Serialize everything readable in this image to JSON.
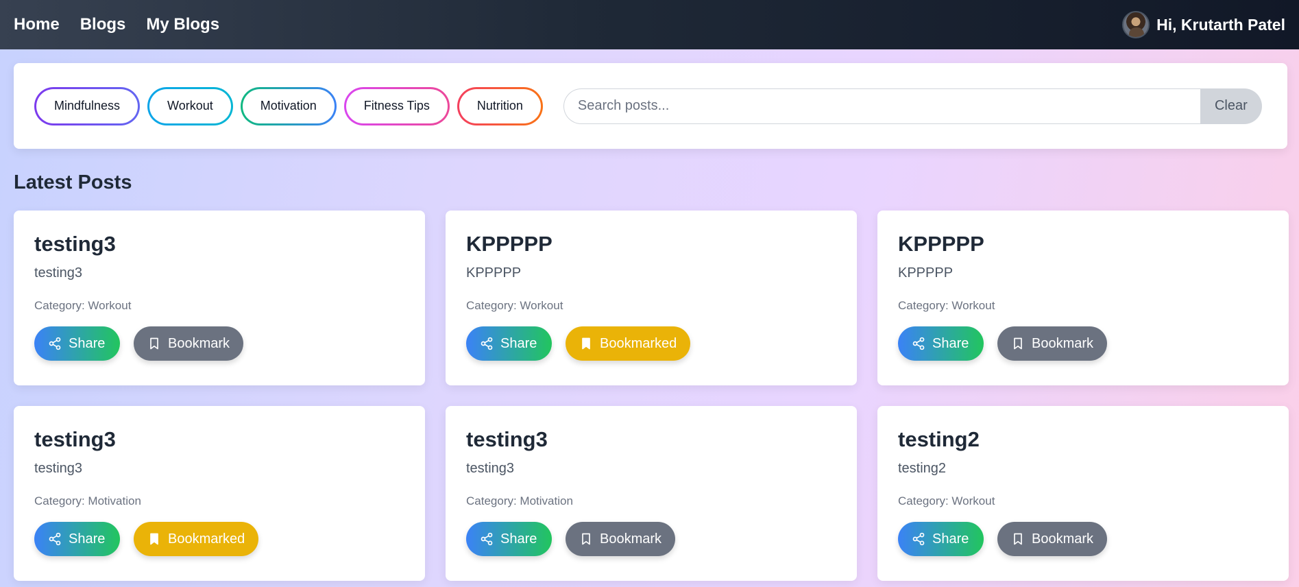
{
  "nav": {
    "links": [
      "Home",
      "Blogs",
      "My Blogs"
    ],
    "greeting": "Hi, Krutarth Patel"
  },
  "filters": {
    "chips": [
      "Mindfulness",
      "Workout",
      "Motivation",
      "Fitness Tips",
      "Nutrition"
    ],
    "search_placeholder": "Search posts...",
    "search_value": "",
    "clear_label": "Clear"
  },
  "section_title": "Latest Posts",
  "posts": [
    {
      "title": "testing3",
      "body": "testing3",
      "category": "Category: Workout",
      "share": "Share",
      "bookmark": "Bookmark",
      "bookmarked": false
    },
    {
      "title": "KPPPPP",
      "body": "KPPPPP",
      "category": "Category: Workout",
      "share": "Share",
      "bookmark": "Bookmarked",
      "bookmarked": true
    },
    {
      "title": "KPPPPP",
      "body": "KPPPPP",
      "category": "Category: Workout",
      "share": "Share",
      "bookmark": "Bookmark",
      "bookmarked": false
    },
    {
      "title": "testing3",
      "body": "testing3",
      "category": "Category: Motivation",
      "share": "Share",
      "bookmark": "Bookmarked",
      "bookmarked": true
    },
    {
      "title": "testing3",
      "body": "testing3",
      "category": "Category: Motivation",
      "share": "Share",
      "bookmark": "Bookmark",
      "bookmarked": false
    },
    {
      "title": "testing2",
      "body": "testing2",
      "category": "Category: Workout",
      "share": "Share",
      "bookmark": "Bookmark",
      "bookmarked": false
    }
  ],
  "colors": {
    "bookmark_gray": "#6b7280",
    "bookmarked_yellow": "#eab308",
    "share_gradient_start": "#3b82f6",
    "share_gradient_end": "#22c55e"
  },
  "icons": {
    "share": "share-icon",
    "bookmark": "bookmark-outline-icon",
    "bookmarked": "bookmark-filled-icon"
  }
}
